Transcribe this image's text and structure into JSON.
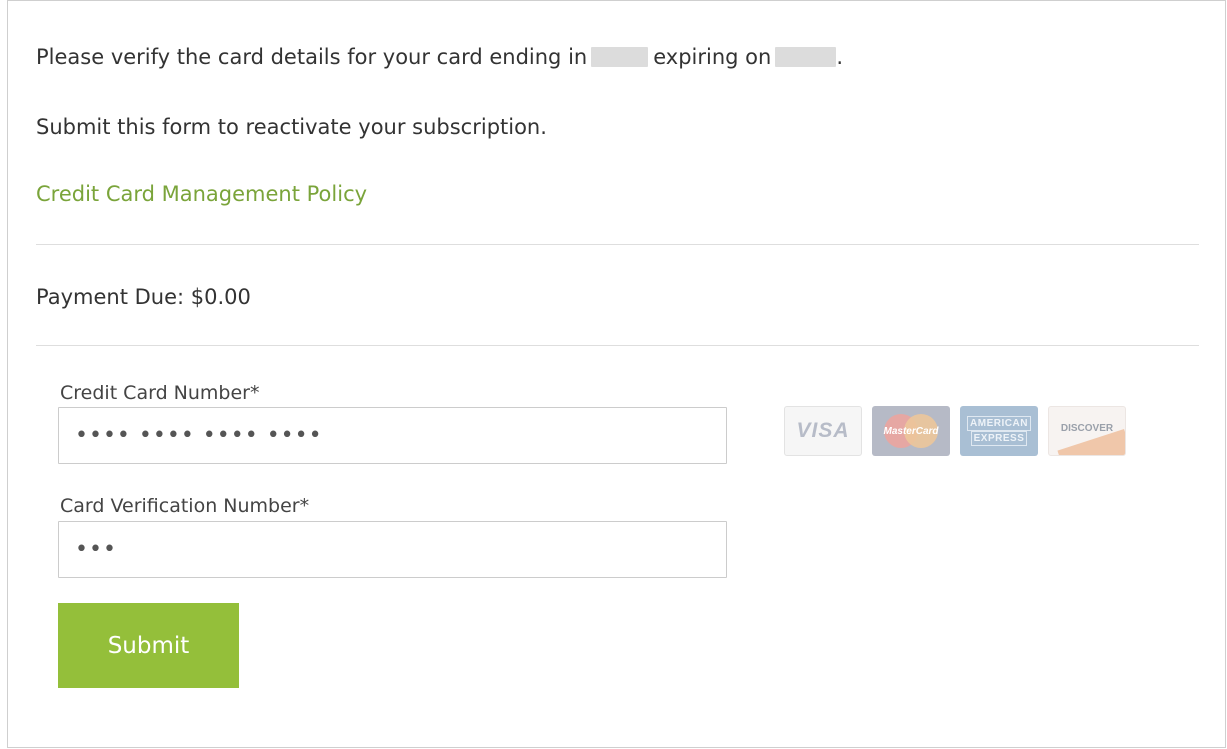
{
  "intro": {
    "prefix": "Please verify the card details for your card ending in",
    "middle": "expiring on",
    "suffix": "."
  },
  "subtitle": "Submit this form to reactivate your subscription.",
  "policy_link": "Credit Card Management Policy",
  "payment_due": "Payment Due: $0.00",
  "form": {
    "card_number_label": "Credit Card Number*",
    "card_number_value": "•••• •••• •••• ••••",
    "cvv_label": "Card Verification Number*",
    "cvv_value": "•••",
    "submit_label": "Submit"
  },
  "card_logos": {
    "visa": "VISA",
    "mastercard": "MasterCard",
    "amex_line1": "AMERICAN",
    "amex_line2": "EXPRESS",
    "discover": "DISCOVER"
  },
  "colors": {
    "link": "#7aa43a",
    "button": "#94bf3a",
    "redaction": "#dcdcdc"
  }
}
